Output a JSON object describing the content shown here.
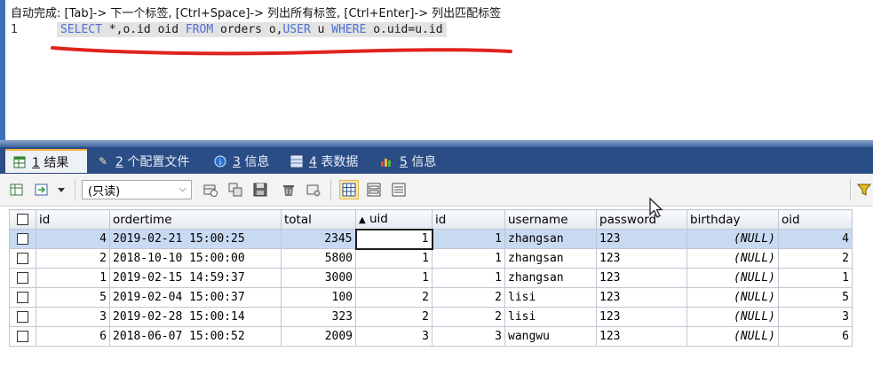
{
  "editor": {
    "autocomplete_hint": "自动完成: [Tab]-> 下一个标签, [Ctrl+Space]-> 列出所有标签, [Ctrl+Enter]-> 列出匹配标签",
    "line_number": "1",
    "sql_tokens": {
      "t1": "SELECT",
      "t2": " *,o.id oid ",
      "t3": "FROM",
      "t4": " orders o,",
      "t5": "USER",
      "t6": " u ",
      "t7": "WHERE",
      "t8": " o.uid=u.id"
    }
  },
  "tabs": [
    {
      "num": "1",
      "label": "结果",
      "icon": "result-grid-icon"
    },
    {
      "num": "2",
      "label": "个配置文件",
      "icon": "profile-icon"
    },
    {
      "num": "3",
      "label": "信息",
      "icon": "info-icon"
    },
    {
      "num": "4",
      "label": "表数据",
      "icon": "table-data-icon"
    },
    {
      "num": "5",
      "label": "信息",
      "icon": "info-chart-icon"
    }
  ],
  "toolbar": {
    "mode_value": "(只读)"
  },
  "grid": {
    "columns": [
      "id",
      "ordertime",
      "total",
      "uid",
      "id",
      "username",
      "password",
      "birthday",
      "oid"
    ],
    "sort_indicator": "▲",
    "rows": [
      [
        "4",
        "2019-02-21 15:00:25",
        "2345",
        "1",
        "1",
        "zhangsan",
        "123",
        "(NULL)",
        "4"
      ],
      [
        "2",
        "2018-10-10 15:00:00",
        "5800",
        "1",
        "1",
        "zhangsan",
        "123",
        "(NULL)",
        "2"
      ],
      [
        "1",
        "2019-02-15 14:59:37",
        "3000",
        "1",
        "1",
        "zhangsan",
        "123",
        "(NULL)",
        "1"
      ],
      [
        "5",
        "2019-02-04 15:00:37",
        "100",
        "2",
        "2",
        "lisi",
        "123",
        "(NULL)",
        "5"
      ],
      [
        "3",
        "2019-02-28 15:00:14",
        "323",
        "2",
        "2",
        "lisi",
        "123",
        "(NULL)",
        "3"
      ],
      [
        "6",
        "2018-06-07 15:00:52",
        "2009",
        "3",
        "3",
        "wangwu",
        "123",
        "(NULL)",
        "6"
      ]
    ]
  },
  "colors": {
    "keyword": "#4f6fd6",
    "tabbar": "#2b4d86",
    "selected_row": "#c8d9f2",
    "annotation_underline": "#e0241d"
  }
}
